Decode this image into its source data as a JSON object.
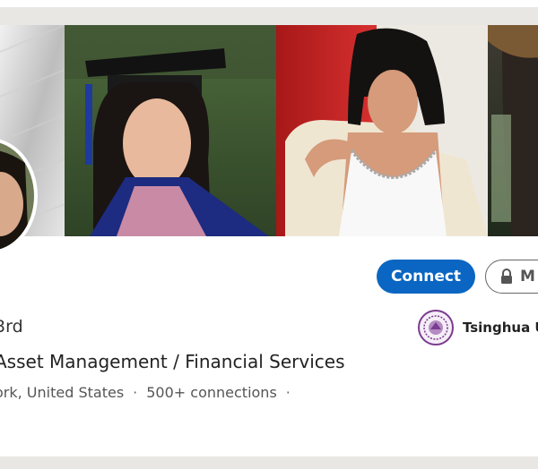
{
  "profile": {
    "degree_badge": "3rd",
    "headline": "Asset Management / Financial Services",
    "location": "ork, United States",
    "connections": "500+ connections",
    "separator": "·",
    "trailing_separator": "·"
  },
  "actions": {
    "connect_label": "Connect",
    "more_label": "M"
  },
  "education": {
    "school_name": "Tsinghua U"
  },
  "colors": {
    "accent": "#0a66c2",
    "page_bg": "#e9e7e4"
  },
  "icons": [
    "lock-icon",
    "university-seal-icon"
  ]
}
